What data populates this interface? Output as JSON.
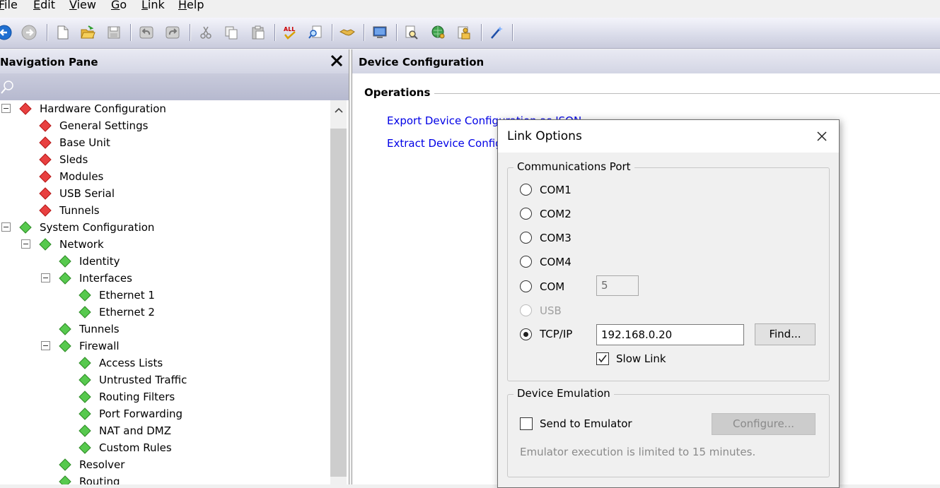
{
  "menu": [
    {
      "label": "File",
      "mnemonic": "F",
      "rest": "ile"
    },
    {
      "label": "Edit",
      "mnemonic": "E",
      "rest": "dit"
    },
    {
      "label": "View",
      "mnemonic": "V",
      "rest": "iew"
    },
    {
      "label": "Go",
      "mnemonic": "G",
      "rest": "o"
    },
    {
      "label": "Link",
      "mnemonic": "L",
      "rest": "ink"
    },
    {
      "label": "Help",
      "mnemonic": "H",
      "rest": "elp"
    }
  ],
  "toolbar_icons": [
    "back-arrow-icon",
    "forward-arrow-icon",
    "new-file-icon",
    "open-folder-icon",
    "save-icon",
    "undo-icon",
    "redo-icon",
    "cut-icon",
    "copy-icon",
    "paste-icon",
    "spellcheck-all-icon",
    "find-icon",
    "link-handshake-icon",
    "monitor-icon",
    "inspect-icon",
    "globe-key-icon",
    "folder-key-icon",
    "wand-icon"
  ],
  "nav": {
    "title": "Navigation Pane",
    "tree": [
      {
        "label": "Hardware Configuration",
        "color": "red",
        "level": 0,
        "expander": true
      },
      {
        "label": "General Settings",
        "color": "red",
        "level": 1
      },
      {
        "label": "Base Unit",
        "color": "red",
        "level": 1
      },
      {
        "label": "Sleds",
        "color": "red",
        "level": 1
      },
      {
        "label": "Modules",
        "color": "red",
        "level": 1
      },
      {
        "label": "USB Serial",
        "color": "red",
        "level": 1
      },
      {
        "label": "Tunnels",
        "color": "red",
        "level": 1
      },
      {
        "label": "System Configuration",
        "color": "green",
        "level": 0,
        "expander": true
      },
      {
        "label": "Network",
        "color": "green",
        "level": 1,
        "expander": true
      },
      {
        "label": "Identity",
        "color": "green",
        "level": 2
      },
      {
        "label": "Interfaces",
        "color": "green",
        "level": 2,
        "expander": true
      },
      {
        "label": "Ethernet 1",
        "color": "green",
        "level": 3
      },
      {
        "label": "Ethernet 2",
        "color": "green",
        "level": 3
      },
      {
        "label": "Tunnels",
        "color": "green",
        "level": 2
      },
      {
        "label": "Firewall",
        "color": "green",
        "level": 2,
        "expander": true
      },
      {
        "label": "Access Lists",
        "color": "green",
        "level": 3
      },
      {
        "label": "Untrusted Traffic",
        "color": "green",
        "level": 3
      },
      {
        "label": "Routing Filters",
        "color": "green",
        "level": 3
      },
      {
        "label": "Port Forwarding",
        "color": "green",
        "level": 3
      },
      {
        "label": "NAT and DMZ",
        "color": "green",
        "level": 3
      },
      {
        "label": "Custom Rules",
        "color": "green",
        "level": 3
      },
      {
        "label": "Resolver",
        "color": "green",
        "level": 2
      },
      {
        "label": "Routing",
        "color": "green",
        "level": 2
      }
    ]
  },
  "content": {
    "title": "Device Configuration",
    "section": "Operations",
    "links": [
      "Export Device Configuration as JSON",
      "Extract Device Configuration"
    ]
  },
  "dialog": {
    "title": "Link Options",
    "comm_group": "Communications Port",
    "ports": [
      {
        "label": "COM1",
        "checked": false,
        "disabled": false
      },
      {
        "label": "COM2",
        "checked": false,
        "disabled": false
      },
      {
        "label": "COM3",
        "checked": false,
        "disabled": false
      },
      {
        "label": "COM4",
        "checked": false,
        "disabled": false
      },
      {
        "label": "COM",
        "checked": false,
        "disabled": false
      },
      {
        "label": "USB",
        "checked": false,
        "disabled": true
      },
      {
        "label": "TCP/IP",
        "checked": true,
        "disabled": false
      }
    ],
    "com_number": "5",
    "tcp_address": "192.168.0.20",
    "find_label": "Find...",
    "slow_link_label": "Slow Link",
    "slow_link_checked": true,
    "emulation_group": "Device Emulation",
    "send_to_emulator_label": "Send to Emulator",
    "send_to_emulator_checked": false,
    "configure_label": "Configure...",
    "emulator_hint": "Emulator execution is limited to 15 minutes."
  }
}
